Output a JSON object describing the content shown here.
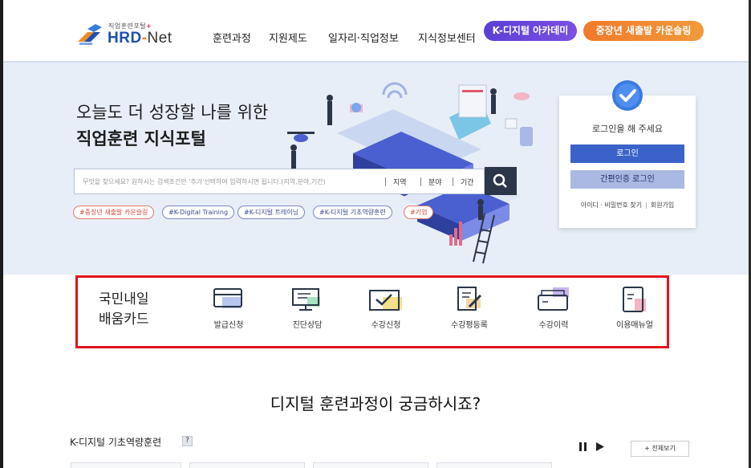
{
  "header": {
    "logo_sub": "직업훈련포털",
    "logo_plus": "+",
    "logo_hrd": "HRD",
    "logo_dash": "-",
    "logo_net": "Net",
    "nav": [
      "훈련과정",
      "지원제도",
      "일자리·직업정보",
      "지식정보센터"
    ],
    "pill_digital": "K-디지털 아카데미",
    "pill_counsel": "중장년 새출발 카운슬링"
  },
  "hero": {
    "headline_line1": "오늘도 더 성장할 나를 위한",
    "headline_line2": "직업훈련 지식포털",
    "search_placeholder": "무엇을 찾으세요? 원하시는 검색조건만 '추가'선택하여 입력하시면 됩니다.(지역,분야,기간)",
    "filters": [
      "지역",
      "분야",
      "기간"
    ],
    "tags": [
      "#중장년 새출발 카운슬링",
      "#K-Digital Training",
      "#K-디지털 트레이닝",
      "#K-디지털 기초역량훈련",
      "#기업"
    ]
  },
  "login": {
    "title": "로그인을 해 주세요",
    "login_button": "로그인",
    "cert_login_button": "간편인증 로그인",
    "find_link": "아이디 · 비밀번호 찾기",
    "join_link": "회원가입"
  },
  "card_section": {
    "title_line1": "국민내일",
    "title_line2": "배움카드",
    "items": [
      "발급신청",
      "진단상담",
      "수강신청",
      "수강평등록",
      "수강이력",
      "이용매뉴얼"
    ]
  },
  "lower": {
    "section_title": "디지털 훈련과정이 궁금하시죠?",
    "sub_title": "K-디지털 기초역량훈련",
    "help": "?",
    "view_all": "+ 전체보기"
  },
  "colors": {
    "accent_blue": "#3a62c9",
    "highlight_red": "#e1121b",
    "pill_purple": "#5b3fd6",
    "pill_orange": "#f07a2a",
    "hero_bg": "#e7eef7"
  }
}
